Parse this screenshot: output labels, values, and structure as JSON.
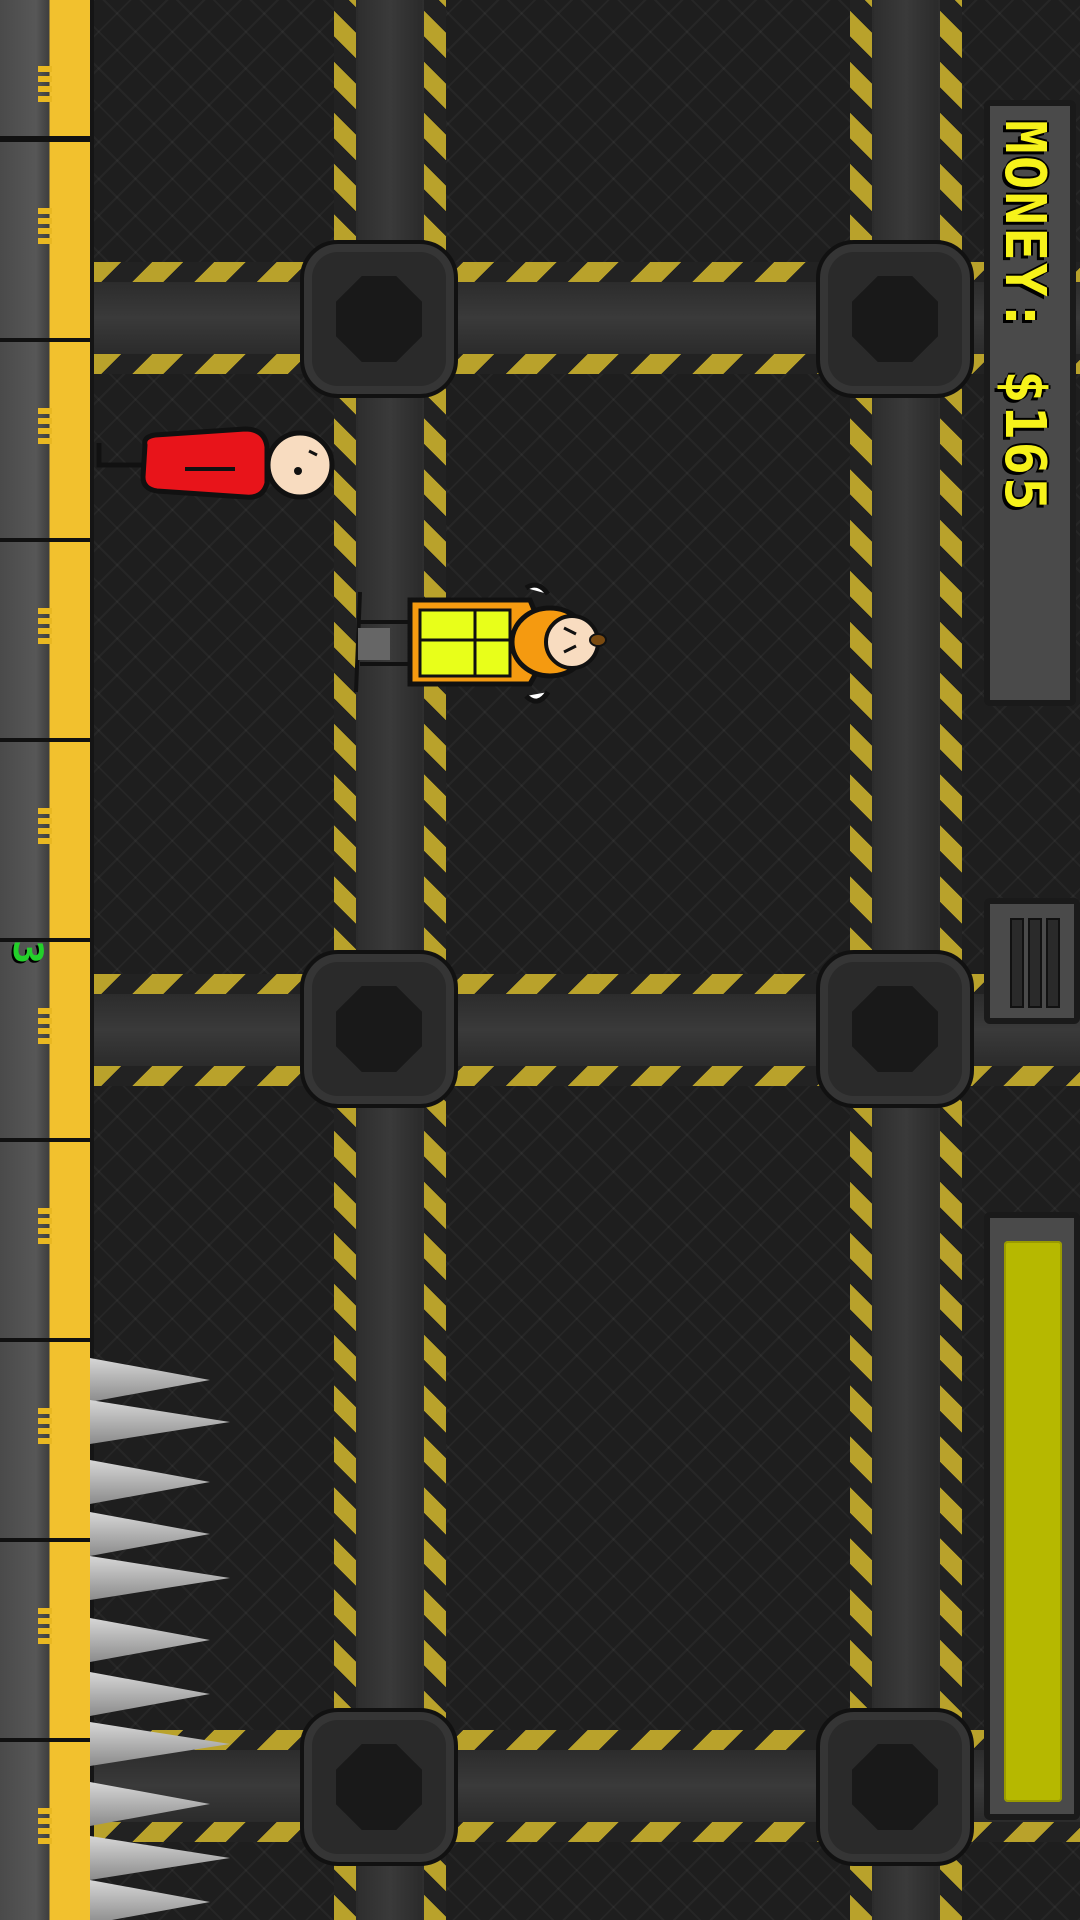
{
  "hud": {
    "money_text": "MONEY: $165",
    "counter": "3",
    "energy_fraction": 0.98
  },
  "colors": {
    "money_text": "#f6f21a",
    "counter_text": "#23d12a",
    "hazard_stripe": "#b9a22b",
    "energy_fill": "#b6b800",
    "enemy_body": "#e8141a",
    "player_suit": "#f59a10",
    "player_vest": "#e8ff1a"
  },
  "icons": {
    "pause": "pause-icon",
    "spikes": "spike-trap-icon"
  }
}
